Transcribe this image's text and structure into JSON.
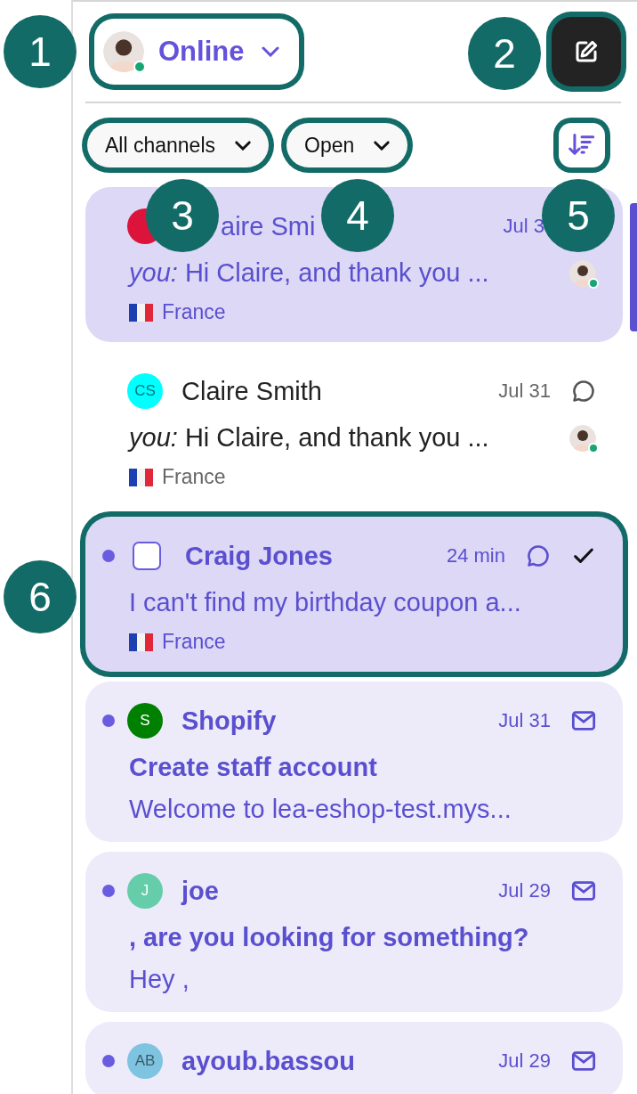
{
  "header": {
    "status": {
      "label": "Online",
      "online": true,
      "outlined": true
    },
    "compose": {
      "outlined": true
    }
  },
  "filters": [
    {
      "label": "All channels",
      "outlined": true
    },
    {
      "label": "Open",
      "outlined": true
    }
  ],
  "sort": {
    "outlined": true
  },
  "conversations": [
    {
      "kind": "chat",
      "selected": true,
      "unread": false,
      "covered": true,
      "color": "#dc143c",
      "name": "aire Smi",
      "time": "Jul 3",
      "author": "you:",
      "preview": "Hi Claire, and thank you ...",
      "agent_online": true,
      "country": "France"
    },
    {
      "kind": "chat",
      "selected": false,
      "unread": false,
      "covered": false,
      "initials": "CS",
      "color": "#00ffff",
      "name": "Claire Smith",
      "time": "Jul 31",
      "author": "you:",
      "preview": "Hi Claire, and thank you ...",
      "agent_online": true,
      "country": "France"
    },
    {
      "kind": "chat",
      "selected": true,
      "unread": true,
      "covered": false,
      "hovered": true,
      "checked": false,
      "outlined": true,
      "name": "Craig Jones",
      "time": "24 min",
      "preview": "I can't find my birthday coupon a...",
      "country": "France"
    },
    {
      "kind": "email",
      "selected": false,
      "unread": true,
      "covered": false,
      "initials": "S",
      "color": "#008000",
      "name": "Shopify",
      "time": "Jul 31",
      "subject": "Create staff account",
      "preview": "Welcome to lea-eshop-test.mys..."
    },
    {
      "kind": "email",
      "selected": false,
      "unread": true,
      "covered": false,
      "initials": "J",
      "color": "#66cdaa",
      "name": "joe",
      "time": "Jul 29",
      "subject": ", are you looking for something?",
      "preview": "Hey ,"
    },
    {
      "kind": "email",
      "selected": false,
      "unread": true,
      "covered": false,
      "initials": "AB",
      "color": "#7ec4e0",
      "name": "ayoub.bassou",
      "time": "Jul 29"
    }
  ],
  "callouts": [
    "1",
    "2",
    "3",
    "4",
    "5",
    "6"
  ]
}
